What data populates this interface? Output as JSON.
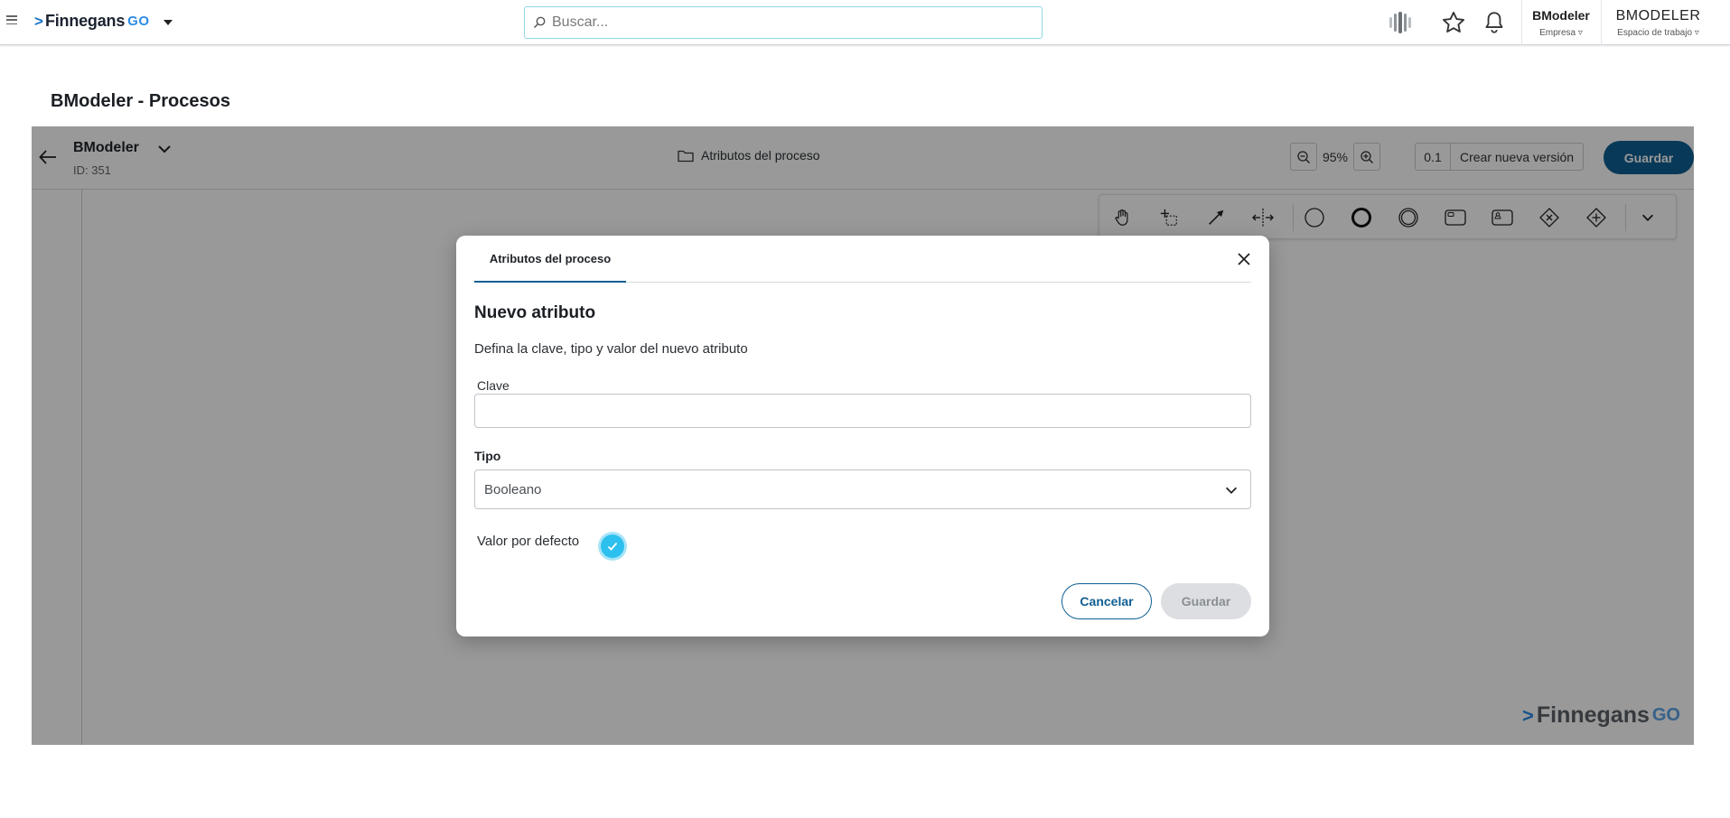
{
  "topbar": {
    "logo_name": "Finnegans",
    "logo_suffix": "GO",
    "search_placeholder": "Buscar...",
    "company_name": "BModeler",
    "company_label": "Empresa ▿",
    "workspace_name": "BMODELER",
    "workspace_label": "Espacio de trabajo ▿"
  },
  "page": {
    "title": "BModeler - Procesos"
  },
  "editor": {
    "model_name": "BModeler",
    "model_id": "ID: 351",
    "attributes_link": "Atributos del proceso",
    "zoom": "95%",
    "version_number": "0.1",
    "new_version_label": "Crear nueva versión",
    "save_label": "Guardar",
    "palette_tools": [
      "hand-tool",
      "lasso-tool",
      "connect-tool",
      "space-tool",
      "start-event",
      "end-event",
      "intermediate-event",
      "task",
      "user-task",
      "exclusive-gateway",
      "parallel-gateway"
    ],
    "watermark_name": "Finnegans",
    "watermark_suffix": "GO"
  },
  "modal": {
    "tab_label": "Atributos del proceso",
    "heading": "Nuevo atributo",
    "description": "Defina la clave, tipo y valor del nuevo atributo",
    "clave_label": "Clave",
    "clave_value": "",
    "tipo_label": "Tipo",
    "tipo_value": "Booleano",
    "valor_label": "Valor por defecto",
    "valor_checked": true,
    "cancel_label": "Cancelar",
    "save_label": "Guardar"
  },
  "colors": {
    "primary": "#0f5f93",
    "accent": "#2cc0ef",
    "logo_blue": "#2b8be6"
  }
}
